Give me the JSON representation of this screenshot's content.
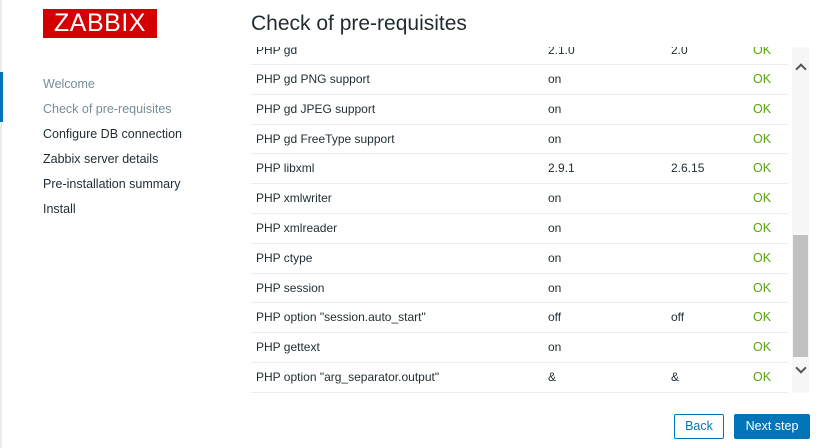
{
  "logo": "ZABBIX",
  "page_title": "Check of pre-requisites",
  "steps": [
    {
      "label": "Welcome"
    },
    {
      "label": "Check of pre-requisites"
    },
    {
      "label": "Configure DB connection"
    },
    {
      "label": "Zabbix server details"
    },
    {
      "label": "Pre-installation summary"
    },
    {
      "label": "Install"
    }
  ],
  "checks": [
    {
      "name": "PHP gd",
      "current": "2.1.0",
      "required": "2.0",
      "result": "OK"
    },
    {
      "name": "PHP gd PNG support",
      "current": "on",
      "required": "",
      "result": "OK"
    },
    {
      "name": "PHP gd JPEG support",
      "current": "on",
      "required": "",
      "result": "OK"
    },
    {
      "name": "PHP gd FreeType support",
      "current": "on",
      "required": "",
      "result": "OK"
    },
    {
      "name": "PHP libxml",
      "current": "2.9.1",
      "required": "2.6.15",
      "result": "OK"
    },
    {
      "name": "PHP xmlwriter",
      "current": "on",
      "required": "",
      "result": "OK"
    },
    {
      "name": "PHP xmlreader",
      "current": "on",
      "required": "",
      "result": "OK"
    },
    {
      "name": "PHP ctype",
      "current": "on",
      "required": "",
      "result": "OK"
    },
    {
      "name": "PHP session",
      "current": "on",
      "required": "",
      "result": "OK"
    },
    {
      "name": "PHP option \"session.auto_start\"",
      "current": "off",
      "required": "off",
      "result": "OK"
    },
    {
      "name": "PHP gettext",
      "current": "on",
      "required": "",
      "result": "OK"
    },
    {
      "name": "PHP option \"arg_separator.output\"",
      "current": "&",
      "required": "&",
      "result": "OK"
    }
  ],
  "buttons": {
    "back": "Back",
    "next": "Next step"
  },
  "colors": {
    "logo": "#d40000",
    "accent": "#0275b8",
    "ok": "#59a30e",
    "muted": "#768d99"
  },
  "icons": {
    "scroll_up": "chevron-up-icon",
    "scroll_down": "chevron-down-icon"
  }
}
